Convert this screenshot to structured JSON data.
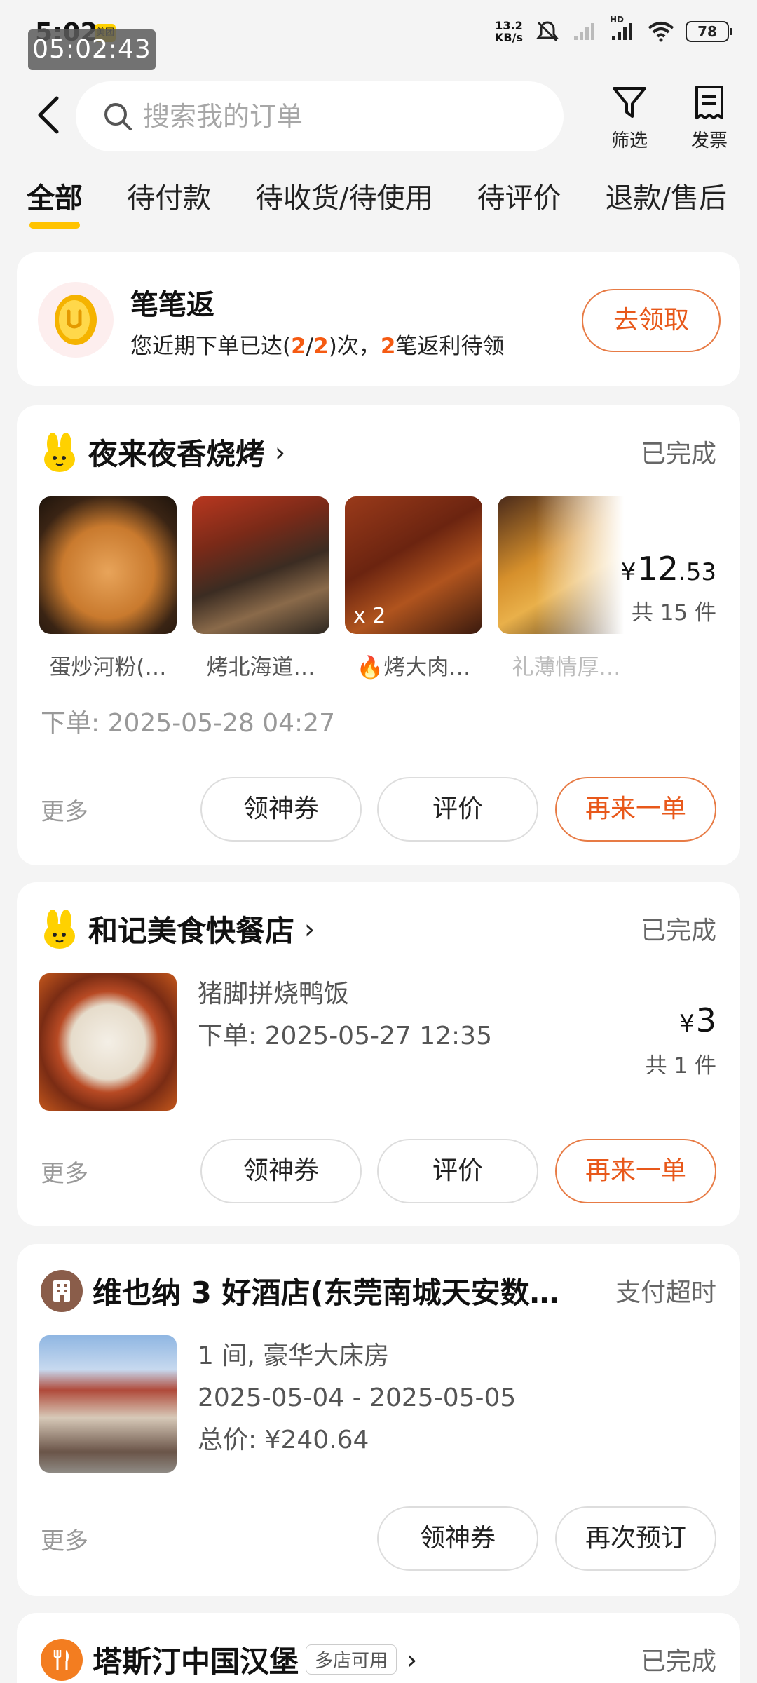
{
  "status_bar": {
    "time": "5:02",
    "app_badge": "美团",
    "timer": "05:02:43",
    "net_speed_value": "13.2",
    "net_speed_unit": "KB/s",
    "hd_label": "HD",
    "battery": "78"
  },
  "header": {
    "search_placeholder": "搜索我的订单",
    "filter_label": "筛选",
    "invoice_label": "发票"
  },
  "tabs": [
    {
      "label": "全部",
      "active": true
    },
    {
      "label": "待付款"
    },
    {
      "label": "待收货/待使用"
    },
    {
      "label": "待评价"
    },
    {
      "label": "退款/售后"
    }
  ],
  "promo": {
    "title": "笔笔返",
    "desc_1": "您近期下单已达(",
    "desc_2": "2",
    "desc_3": "/",
    "desc_4": "2",
    "desc_5": ")次，",
    "desc_6": "2",
    "desc_7": "笔返利待领",
    "button": "去领取"
  },
  "orders": [
    {
      "store": "夜来夜香烧烤",
      "status": "已完成",
      "items": [
        {
          "name": "蛋炒河粉(…"
        },
        {
          "name": "烤北海道…"
        },
        {
          "name": "🔥烤大肉…",
          "qty": "x 2"
        },
        {
          "name": "礼薄情厚…"
        }
      ],
      "price_symbol": "¥",
      "price_int": "12",
      "price_dec": ".53",
      "count": "共 15 件",
      "order_time": "下单: 2025-05-28 04:27",
      "more": "更多",
      "buttons": [
        "领神券",
        "评价",
        "再来一单"
      ]
    },
    {
      "store": "和记美食快餐店",
      "status": "已完成",
      "item_name": "猪脚拼烧鸭饭",
      "order_time": "下单: 2025-05-27 12:35",
      "price_symbol": "¥",
      "price_int": "3",
      "count": "共 1 件",
      "more": "更多",
      "buttons": [
        "领神券",
        "评价",
        "再来一单"
      ]
    },
    {
      "store": "维也纳 3 好酒店(东莞南城天安数…",
      "status": "支付超时",
      "line_1": "1 间, 豪华大床房",
      "line_2": "2025-05-04 - 2025-05-05",
      "line_3": "总价: ¥240.64",
      "more": "更多",
      "buttons": [
        "领神券",
        "再次预订"
      ]
    },
    {
      "store": "塔斯汀中国汉堡",
      "tag": "多店可用",
      "status": "已完成"
    }
  ],
  "colors": {
    "accent_orange": "#e8581a",
    "tab_underline": "#ffc300",
    "background": "#f4f4f4"
  }
}
